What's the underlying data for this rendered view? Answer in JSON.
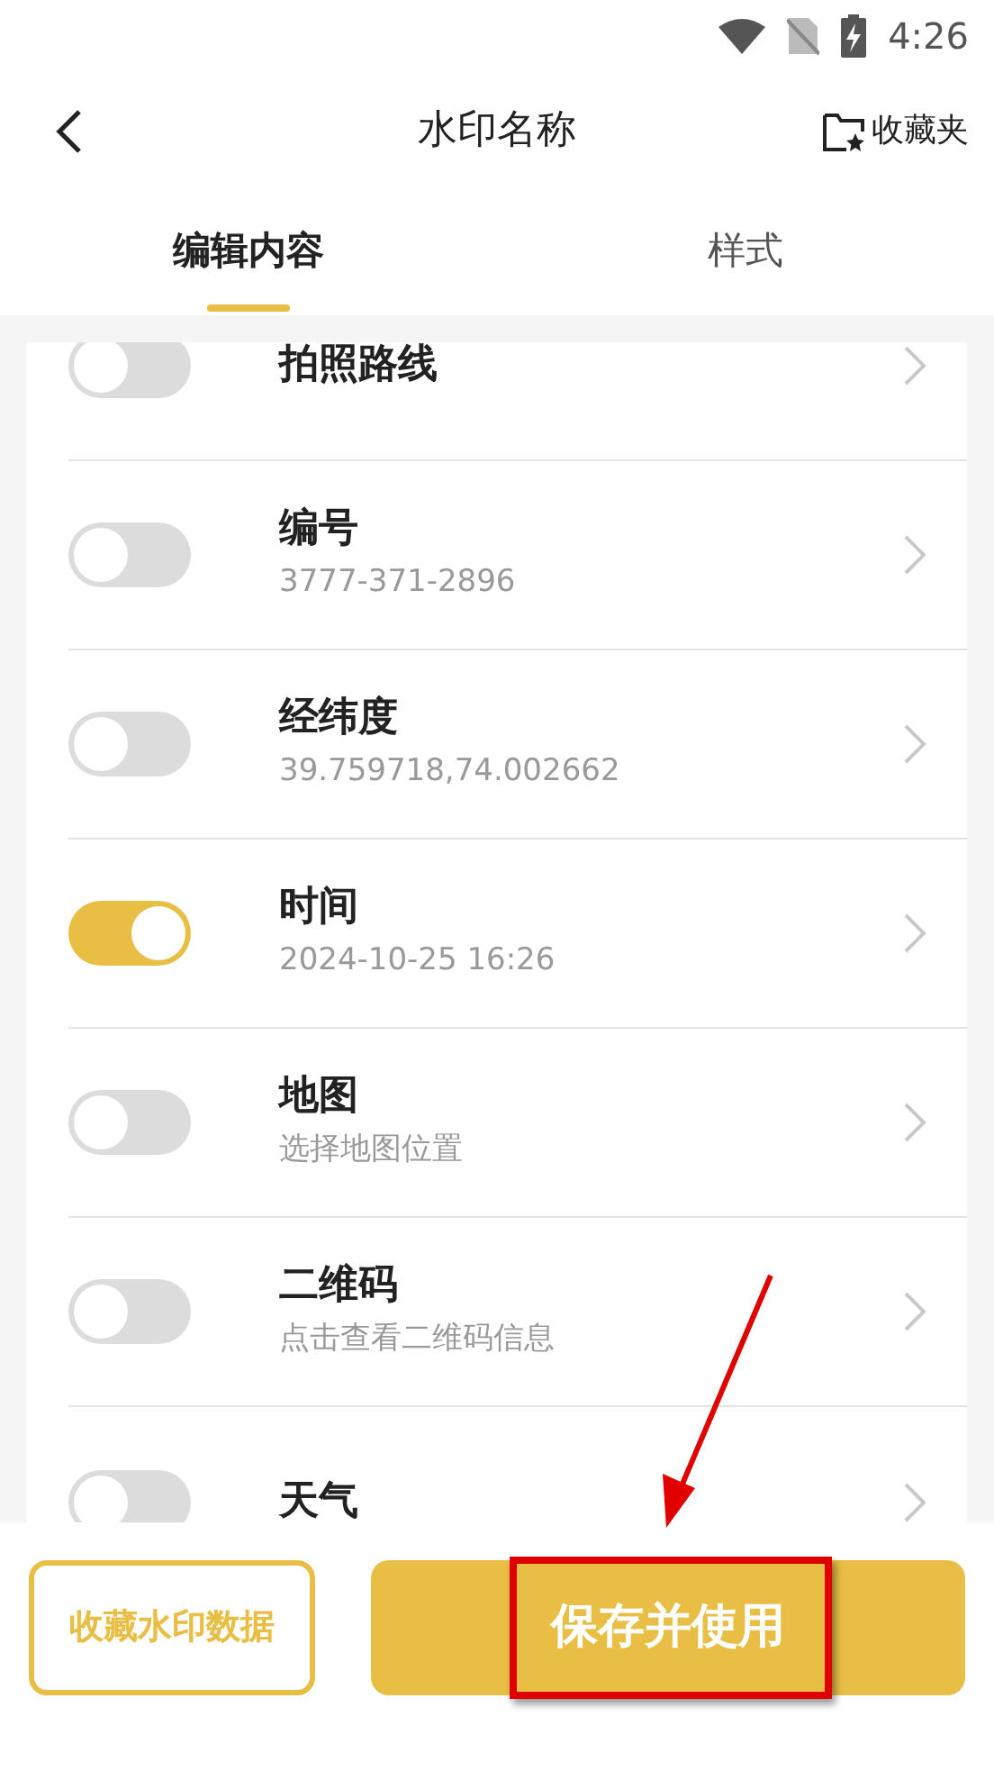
{
  "status_bar": {
    "time": "4:26"
  },
  "header": {
    "title": "水印名称",
    "favorites": "收藏夹"
  },
  "tabs": [
    {
      "label": "编辑内容",
      "selected": true
    },
    {
      "label": "样式",
      "selected": false
    }
  ],
  "items": [
    {
      "title": "拍照路线",
      "on": false
    },
    {
      "title": "编号",
      "subtitle": "3777-371-2896",
      "on": false
    },
    {
      "title": "经纬度",
      "subtitle": "39.759718,74.002662",
      "on": false
    },
    {
      "title": "时间",
      "subtitle": "2024-10-25 16:26",
      "on": true
    },
    {
      "title": "地图",
      "subtitle": "选择地图位置",
      "on": false
    },
    {
      "title": "二维码",
      "subtitle": "点击查看二维码信息",
      "on": false
    },
    {
      "title": "天气",
      "on": false
    }
  ],
  "buttons": {
    "secondary": "收藏水印数据",
    "primary": "保存并使用"
  }
}
